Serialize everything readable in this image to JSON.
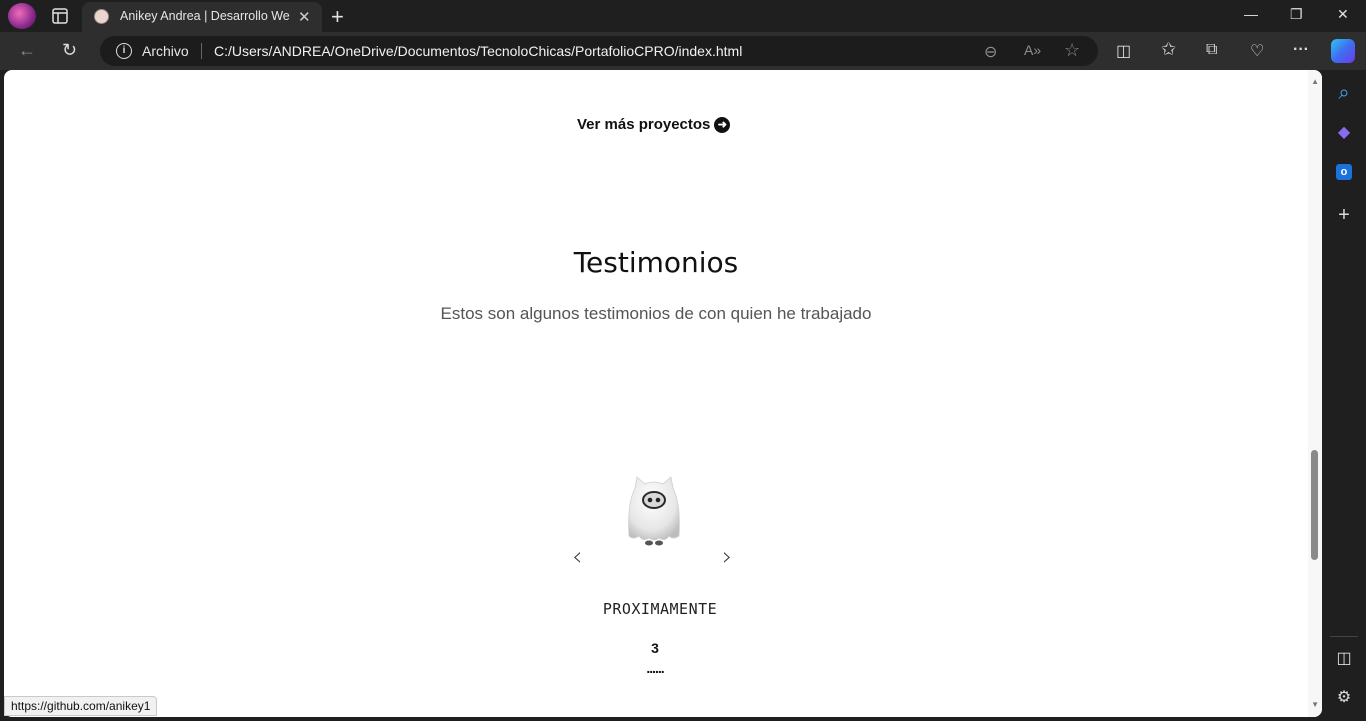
{
  "browser": {
    "tab_title": "Anikey Andrea | Desarrollo Web I",
    "tab_close": "✕",
    "new_tab": "+",
    "win_min": "—",
    "win_max": "❐",
    "win_close": "✕",
    "back_icon": "←",
    "reload_icon": "↻",
    "site_info_label": "Archivo",
    "url": "C:/Users/ANDREA/OneDrive/Documentos/TecnoloChicas/PortafolioCPRO/index.html",
    "zoom_icon": "⊖",
    "read_aloud_icon": "A»",
    "favorite_icon": "☆",
    "split_icon": "◫",
    "favorites_icon": "✩",
    "collections_icon": "⧉",
    "health_icon": "♡",
    "more_icon": "···",
    "status_url": "https://github.com/anikey1"
  },
  "sidebar": {
    "search_icon": "⌕",
    "copilot_icon": "◆",
    "outlook_icon": "o",
    "add_icon": "+",
    "panel_icon": "◫",
    "settings_icon": "⚙"
  },
  "page": {
    "ver_mas": "Ver más proyectos",
    "ver_mas_arrow": "➜",
    "testimonios_title": "Testimonios",
    "testimonios_sub": "Estos son algunos testimonios de con quien he trabajado",
    "prev_icon": "‹",
    "next_icon": "›",
    "testimonial_name": "PROXIMAMENTE",
    "testimonial_number": "3",
    "testimonial_dots": "......"
  }
}
